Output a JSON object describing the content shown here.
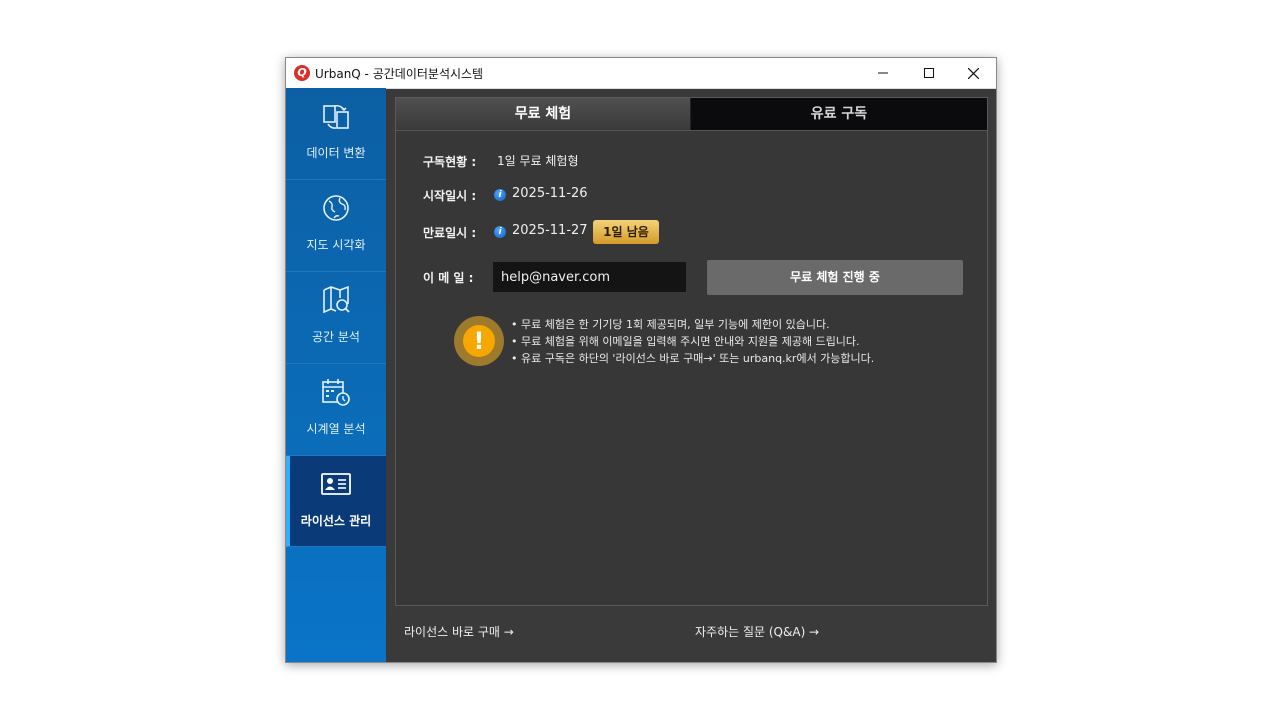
{
  "window": {
    "title": "UrbanQ - 공간데이터분석시스템",
    "logo_letter": "Q"
  },
  "sidebar": {
    "items": [
      {
        "label": "데이터 변환",
        "icon": "data-convert-icon"
      },
      {
        "label": "지도 시각화",
        "icon": "globe-icon"
      },
      {
        "label": "공간 분석",
        "icon": "map-search-icon"
      },
      {
        "label": "시계열 분석",
        "icon": "calendar-clock-icon"
      },
      {
        "label": "라이선스 관리",
        "icon": "id-card-icon",
        "active": true
      }
    ]
  },
  "tabs": {
    "free": "무료 체험",
    "paid": "유료 구독"
  },
  "license": {
    "status_label": "구독현황 :",
    "status_value": "1일 무료 체험형",
    "start_label": "시작일시 :",
    "start_value": "2025-11-26",
    "end_label": "만료일시 :",
    "end_value": "2025-11-27",
    "remaining_badge": "1일 남음",
    "email_label": "이 메 일 :",
    "email_value": "help@naver.com",
    "trial_button": "무료 체험 진행 중",
    "info_glyph": "i",
    "warn_glyph": "!"
  },
  "notes": [
    "• 무료 체험은 한 기기당 1회 제공되며, 일부 기능에 제한이 있습니다.",
    "• 무료 체험을 위해 이메일을 입력해 주시면 안내와 지원을 제공해 드립니다.",
    "• 유료 구독은 하단의 '라이선스 바로 구매→' 또는 urbanq.kr에서 가능합니다."
  ],
  "footer": {
    "buy_link": "라이선스 바로 구매 →",
    "faq_link": "자주하는 질문 (Q&A) →"
  },
  "colors": {
    "sidebar_bg": "#0b6cb9",
    "sidebar_active": "#0a3b78",
    "badge_gold": "#e0b14a",
    "warn": "#f7a800"
  }
}
